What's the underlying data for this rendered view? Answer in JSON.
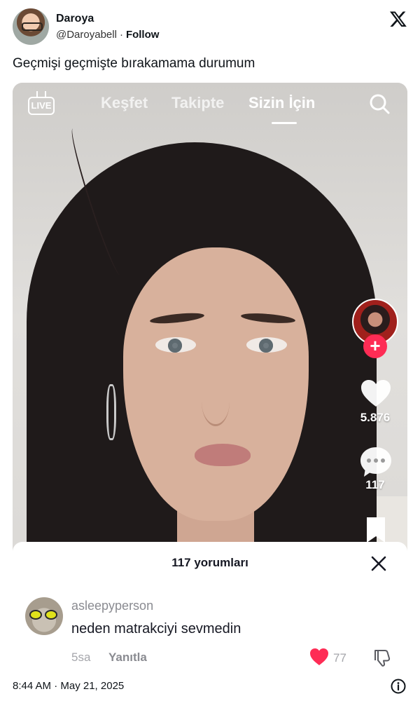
{
  "tweet": {
    "display_name": "Daroya",
    "handle": "@Daroyabell",
    "separator": "·",
    "follow_label": "Follow",
    "text": "Geçmişi geçmişte bırakamama durumum",
    "timestamp": "8:44 AM · May 21, 2025"
  },
  "tiktok": {
    "live_label": "LIVE",
    "tabs": [
      {
        "label": "Keşfet",
        "active": false
      },
      {
        "label": "Takipte",
        "active": false
      },
      {
        "label": "Sizin İçin",
        "active": true
      }
    ],
    "like_count": "5.876",
    "comment_count": "117",
    "accent_color": "#fe2c55"
  },
  "comments_sheet": {
    "title": "117 yorumları",
    "comments": [
      {
        "username": "asleepyperson",
        "text": "neden matrakciyi sevmedin",
        "time": "5sa",
        "reply_label": "Yanıtla",
        "likes": "77",
        "liked": true
      }
    ]
  },
  "icons": {
    "brand": "x-logo-icon",
    "live": "live-tv-icon",
    "search": "search-icon",
    "plus": "plus-icon",
    "like": "heart-icon",
    "comment": "comment-bubble-icon",
    "bookmark": "bookmark-icon",
    "close": "close-icon",
    "dislike": "thumbs-down-icon",
    "info": "info-icon"
  }
}
